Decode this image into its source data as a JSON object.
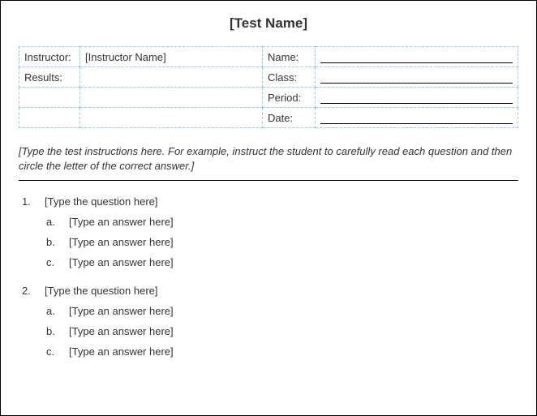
{
  "title": "[Test Name]",
  "info": {
    "instructor_label": "Instructor:",
    "instructor_value": "[Instructor Name]",
    "results_label": "Results:",
    "results_value": "",
    "name_label": "Name:",
    "class_label": "Class:",
    "period_label": "Period:",
    "date_label": "Date:"
  },
  "instructions": "[Type the test instructions here.  For example, instruct the student to carefully read each question and then circle the letter of the correct answer.]",
  "questions": [
    {
      "num": "1.",
      "text": "[Type the question here]",
      "answers": [
        {
          "letter": "a.",
          "text": "[Type an answer here]"
        },
        {
          "letter": "b.",
          "text": "[Type an answer here]"
        },
        {
          "letter": "c.",
          "text": "[Type an answer here]"
        }
      ]
    },
    {
      "num": "2.",
      "text": "[Type the question here]",
      "answers": [
        {
          "letter": "a.",
          "text": "[Type an answer here]"
        },
        {
          "letter": "b.",
          "text": "[Type an answer here]"
        },
        {
          "letter": "c.",
          "text": "[Type an answer here]"
        }
      ]
    }
  ]
}
